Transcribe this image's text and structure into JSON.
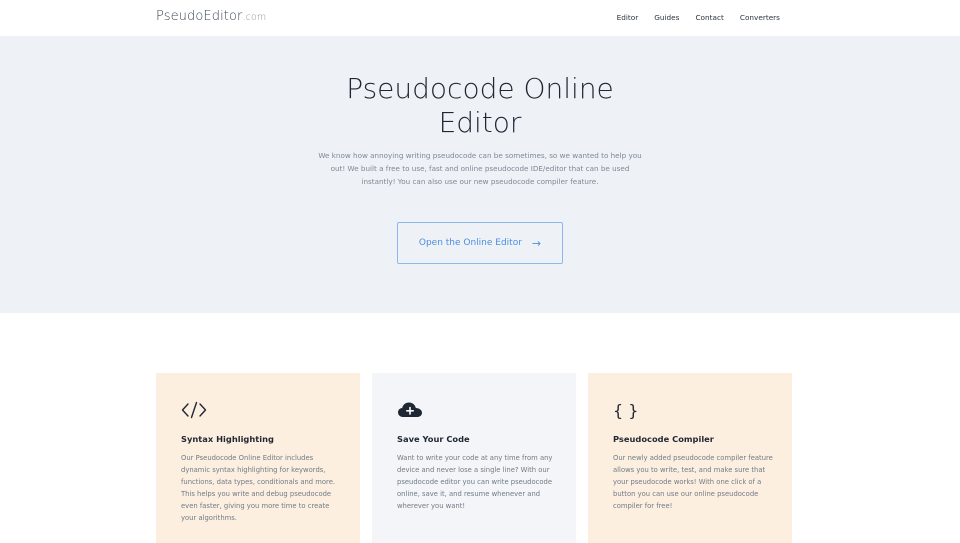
{
  "nav": {
    "logo_main": "PseudoEditor",
    "logo_domain": ".com",
    "links": [
      {
        "label": "Editor"
      },
      {
        "label": "Guides"
      },
      {
        "label": "Contact"
      },
      {
        "label": "Converters"
      }
    ]
  },
  "hero": {
    "title": "Pseudocode Online Editor",
    "description": "We know how annoying writing pseudocode can be sometimes, so we wanted to help you out! We built a free to use, fast and online pseudocode IDE/editor that can be used instantly! You can also use our new pseudocode compiler feature.",
    "cta_label": "Open the Online Editor",
    "cta_icon": "arrow-right-icon",
    "cta_arrow": "→"
  },
  "colors": {
    "hero_bg": "#eef2f7",
    "accent": "#4a8fe0",
    "card_peach": "#fdefe0",
    "card_gray": "#f4f5f8"
  },
  "features": [
    {
      "icon": "code-icon",
      "title": "Syntax Highlighting",
      "text": "Our Pseudocode Online Editor includes dynamic syntax highlighting for keywords, functions, data types, conditionals and more. This helps you write and debug pseudocode even faster, giving you more time to create your algorithms."
    },
    {
      "icon": "cloud-upload-icon",
      "title": "Save Your Code",
      "text": "Want to write your code at any time from any device and never lose a single line? With our pseudocode editor you can write pseudocode online, save it, and resume whenever and wherever you want!"
    },
    {
      "icon": "braces-icon",
      "icon_text": "{ }",
      "title": "Pseudocode Compiler",
      "text": "Our newly added pseudocode compiler feature allows you to write, test, and make sure that your pseudocode works! With one click of a button you can use our online pseudocode compiler for free!"
    }
  ]
}
